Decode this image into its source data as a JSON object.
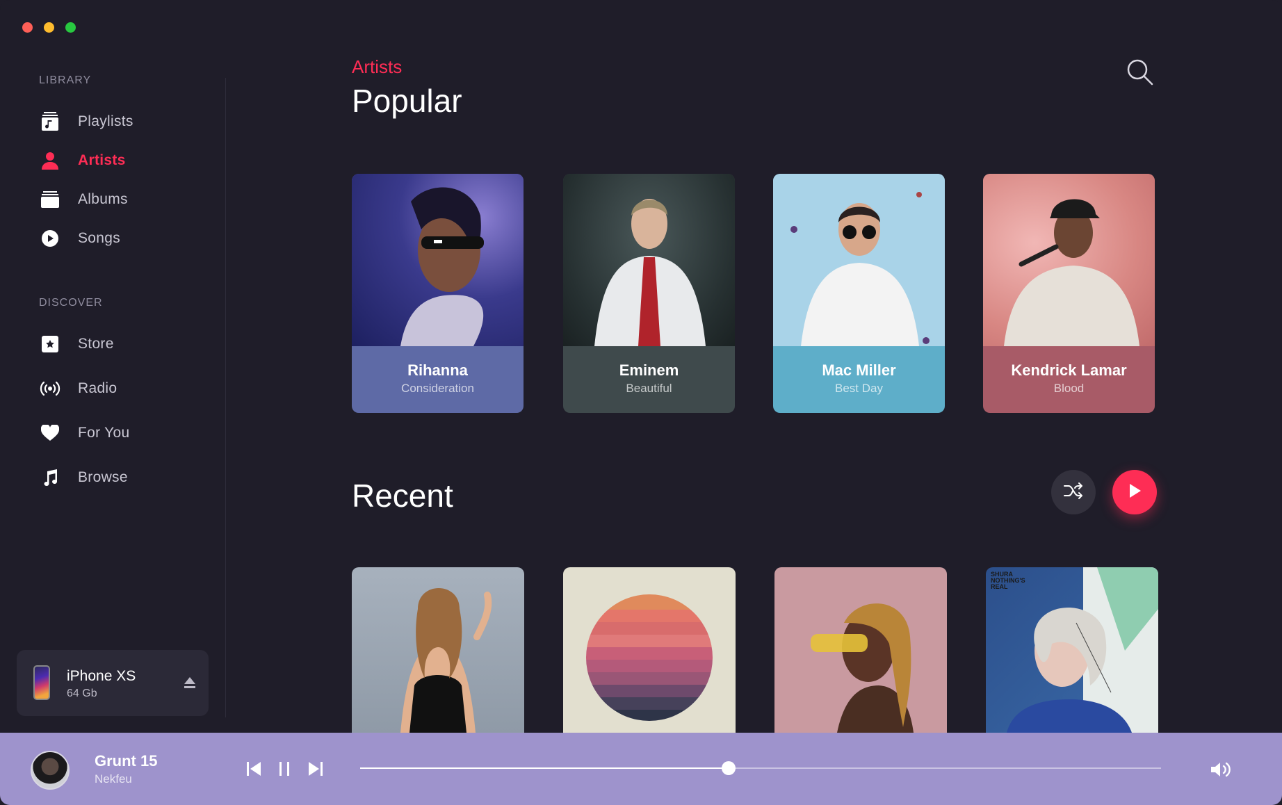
{
  "sidebar": {
    "library_label": "LIBRARY",
    "library_items": [
      {
        "label": "Playlists",
        "icon": "playlist-icon"
      },
      {
        "label": "Artists",
        "icon": "person-icon",
        "active": true
      },
      {
        "label": "Albums",
        "icon": "albums-icon"
      },
      {
        "label": "Songs",
        "icon": "play-circle-icon"
      }
    ],
    "discover_label": "DISCOVER",
    "discover_items": [
      {
        "label": "Store",
        "icon": "star-icon"
      },
      {
        "label": "Radio",
        "icon": "radio-icon"
      },
      {
        "label": "For You",
        "icon": "heart-icon"
      },
      {
        "label": "Browse",
        "icon": "music-note-icon"
      }
    ],
    "device": {
      "name": "iPhone XS",
      "capacity": "64 Gb"
    }
  },
  "header": {
    "breadcrumb": "Artists",
    "title": "Popular"
  },
  "popular": [
    {
      "artist": "Rihanna",
      "song": "Consideration",
      "color": "#5e6aa6"
    },
    {
      "artist": "Eminem",
      "song": "Beautiful",
      "color": "#3f4a4c"
    },
    {
      "artist": "Mac Miller",
      "song": "Best Day",
      "color": "#5eaec9"
    },
    {
      "artist": "Kendrick Lamar",
      "song": "Blood",
      "color": "#a85b67"
    }
  ],
  "recent": {
    "title": "Recent",
    "albums": [
      {
        "cover_text": ""
      },
      {
        "cover_text": ""
      },
      {
        "cover_text": ""
      },
      {
        "cover_text": "SHURA NOTHING'S REAL"
      }
    ]
  },
  "player": {
    "title": "Grunt 15",
    "artist": "Nekfeu",
    "progress": 0.46
  },
  "colors": {
    "accent": "#fe2d55",
    "background": "#1f1d29",
    "player": "#9e93cc"
  }
}
